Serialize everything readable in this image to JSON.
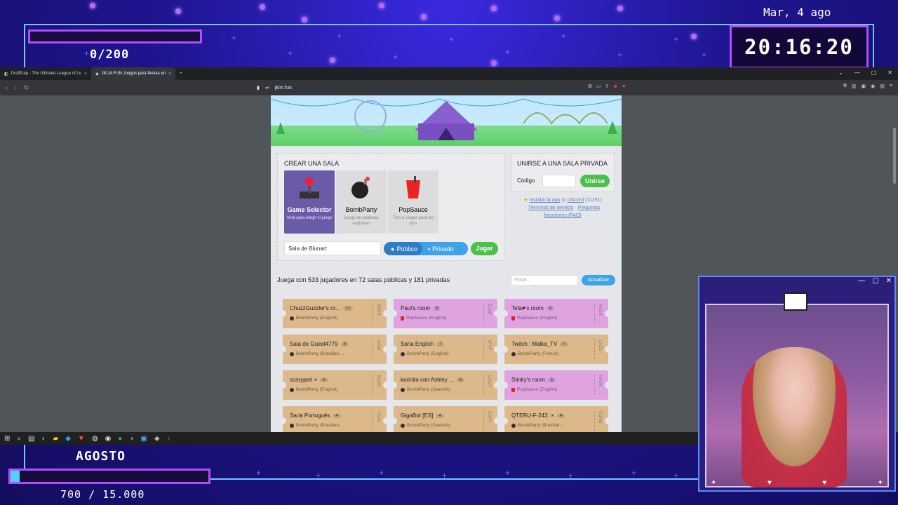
{
  "overlay": {
    "date": "Mar, 4 ago",
    "clock": "20:16:20",
    "top_progress_text": "0/200",
    "month": "AGOSTO",
    "bottom_progress_text": "700 / 15.000",
    "bottom_progress_fraction": 0.047,
    "accent_color": "#b34cff"
  },
  "browser": {
    "tabs": [
      {
        "label": "DraftGap - The Ultimate League of Le"
      },
      {
        "label": "JKLM.FUN Juegos para fiestas en"
      }
    ],
    "url": "jklm.fun"
  },
  "create": {
    "title": "CREAR UNA SALA",
    "games": [
      {
        "name": "Game Selector",
        "desc": "Vota para elegir el juego",
        "icon": "joystick-icon"
      },
      {
        "name": "BombParty",
        "desc": "Juego de palabras explosivo",
        "icon": "bomb-icon"
      },
      {
        "name": "PopSauce",
        "desc": "Test a ciegas para los ojos",
        "icon": "cup-icon"
      }
    ],
    "room_name": "Sala de Blunart",
    "public_label": "Público",
    "private_label": "Privado",
    "play_label": "Jugar"
  },
  "join": {
    "title": "UNIRSE A UNA SALA PRIVADA",
    "code_label": "Código",
    "join_label": "Unirse"
  },
  "links": {
    "install": "Instalar la app",
    "discord": "Discord",
    "discord_count": "(11251)",
    "terms": "Términos de servicio",
    "faq": "Preguntas frecuentes (FAQ)"
  },
  "rooms_header": {
    "text": "Juega con 533 jugadores en 72 salas públicas y 181 privadas",
    "filter_placeholder": "Filtrar...",
    "refresh_label": "Actualizar"
  },
  "rooms": [
    {
      "name": "ChuzzGuzzler's ro...",
      "count": "17",
      "game": "BombParty (English)",
      "code": "ZMPR",
      "kind": "bomb"
    },
    {
      "name": "Paul's room",
      "count": "9",
      "game": "PopSauce (English)",
      "code": "EONF",
      "kind": "pop"
    },
    {
      "name": "Tefa♥'s room",
      "count": "8",
      "game": "PopSauce (English)",
      "code": "AVQH",
      "kind": "pop"
    },
    {
      "name": "Sala de Guest4779",
      "count": "8",
      "game": "BombParty (Brazilian ...",
      "code": "ACIW",
      "kind": "bomb"
    },
    {
      "name": "Saria English",
      "count": "7",
      "game": "BombParty (English)",
      "code": "VFVF",
      "kind": "bomb"
    },
    {
      "name": "Twitch : Malka_TV",
      "count": "7",
      "game": "BombParty (French)",
      "code": "CAZD",
      "kind": "bomb"
    },
    {
      "name": "scaryperi ×",
      "count": "6",
      "game": "BombParty (English)",
      "code": "BQXS",
      "kind": "bomb"
    },
    {
      "name": "karinita con Ashley ...",
      "count": "6",
      "game": "BombParty (Spanish)",
      "code": "UAUY",
      "kind": "bomb"
    },
    {
      "name": "Stinky's room",
      "count": "5",
      "game": "PopSauce (English)",
      "code": "HASK",
      "kind": "pop"
    },
    {
      "name": "Saria Português",
      "count": "4",
      "game": "BombParty (Brazilian ...",
      "code": "VSAS",
      "kind": "bomb"
    },
    {
      "name": "GigaBot [ES]",
      "count": "4",
      "game": "BombParty (Spanish)",
      "code": "CSFH",
      "kind": "bomb"
    },
    {
      "name": "QTERU-F-243. ×",
      "count": "4",
      "game": "BombParty (Brazilian ...",
      "code": "XQAQ",
      "kind": "bomb"
    }
  ]
}
